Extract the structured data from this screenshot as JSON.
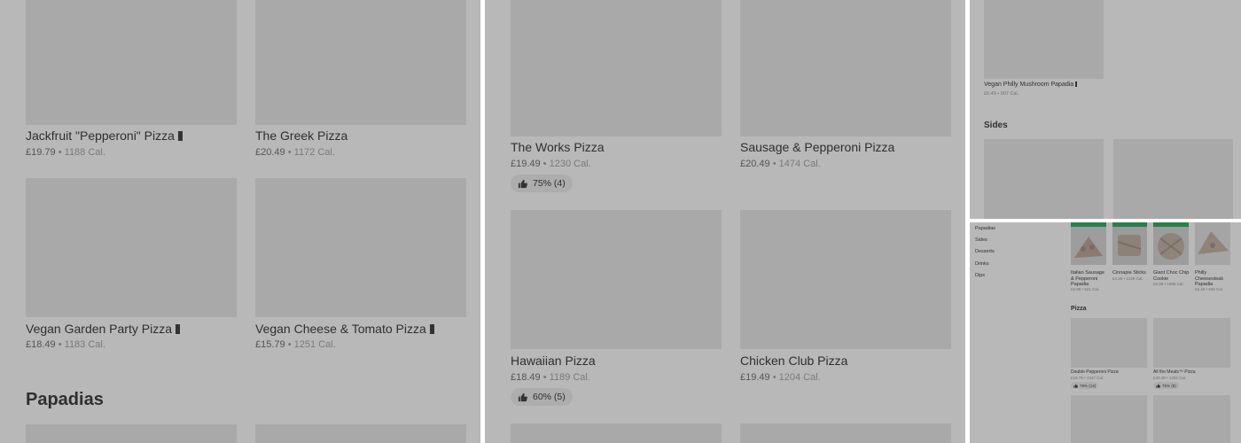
{
  "panel1": {
    "items": [
      {
        "title": "Jackfruit \"Pepperoni\" Pizza",
        "price": "£19.79",
        "calories": "1188 Cal."
      },
      {
        "title": "The Greek Pizza",
        "price": "£20.49",
        "calories": "1172 Cal."
      },
      {
        "title": "Vegan Garden Party Pizza",
        "price": "£18.49",
        "calories": "1183 Cal."
      },
      {
        "title": "Vegan Cheese & Tomato Pizza",
        "price": "£15.79",
        "calories": "1251 Cal."
      }
    ],
    "section_heading": "Papadias"
  },
  "panel2": {
    "items": [
      {
        "title": "The Works Pizza",
        "price": "£19.49",
        "calories": "1230 Cal.",
        "rating": "75% (4)"
      },
      {
        "title": "Sausage & Pepperoni Pizza",
        "price": "£20.49",
        "calories": "1474 Cal."
      },
      {
        "title": "Hawaiian Pizza",
        "price": "£18.49",
        "calories": "1189 Cal.",
        "rating": "60% (5)"
      },
      {
        "title": "Chicken Club Pizza",
        "price": "£19.49",
        "calories": "1204 Cal."
      }
    ]
  },
  "panel3": {
    "item": {
      "title": "Vegan Philly Mushroom Papadia",
      "price": "£6.49",
      "calories": "907 Cal."
    },
    "section_heading": "Sides"
  },
  "panel4": {
    "nav": [
      "Papadias",
      "Sides",
      "Desserts",
      "Drinks",
      "Dips"
    ],
    "top_items": [
      {
        "title": "Italian Sausage & Pepperoni Papadia",
        "meta": "£6.99 • 921 Cal."
      },
      {
        "title": "Cinnapie Sticks",
        "meta": "£4.29 • 1229 Cal."
      },
      {
        "title": "Giant Choc Chip Cookie",
        "meta": "£6.99 • 1996 Cal."
      },
      {
        "title": "Philly Cheesesteak Papadia",
        "meta": "£6.49 • 946 Cal."
      }
    ],
    "section_heading": "Pizza",
    "pizza_items": [
      {
        "title": "Double Pepperoni Pizza",
        "meta": "£19.79 • 1347 Cal.",
        "rating": "79% (14)"
      },
      {
        "title": "All the Meats™ Pizza",
        "meta": "£20.49 • 1302 Cal.",
        "rating": "75% (8)"
      }
    ]
  },
  "colors": {
    "overlay": "#b8b8b8",
    "placeholder": "#a9a9a9",
    "text": "#2f2f2f"
  },
  "icons": [
    "thumbs-up-icon",
    "vegan-badge-icon"
  ]
}
